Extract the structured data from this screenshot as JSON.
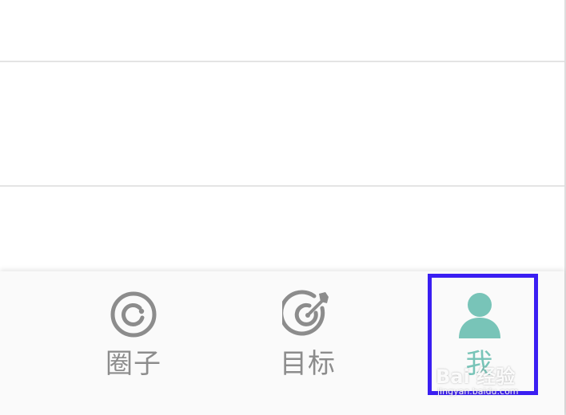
{
  "tabbar": {
    "tabs": [
      {
        "label": "圈子",
        "icon": "circle-icon",
        "active": false
      },
      {
        "label": "目标",
        "icon": "target-icon",
        "active": false
      },
      {
        "label": "我",
        "icon": "user-icon",
        "active": true
      }
    ]
  },
  "colors": {
    "inactive": "#8c8c8c",
    "active": "#78c4b8",
    "highlight_border": "#3a1ef2",
    "divider": "#e4e4e4",
    "tabbar_bg": "#fafafa"
  },
  "watermark": {
    "brand": "Bai 经验",
    "url": "jingyan.baidu.com"
  }
}
